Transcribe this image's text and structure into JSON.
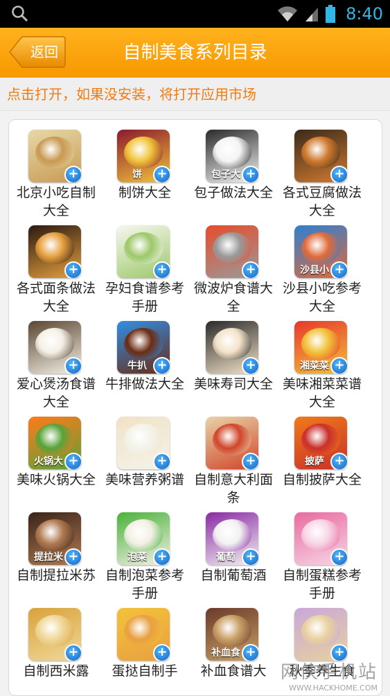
{
  "status_bar": {
    "time": "8:40"
  },
  "header": {
    "back_label": "返回",
    "title": "自制美食系列目录"
  },
  "notice": "点击打开，如果没安装，将打开应用市场",
  "apps": [
    {
      "name": "北京小吃自制大全",
      "icon": "pastry-icon",
      "colors": [
        "#e7d8a8",
        "#c89a52"
      ],
      "tag": ""
    },
    {
      "name": "制饼大全",
      "icon": "pancake-icon",
      "colors": [
        "#8b1a2e",
        "#f2c43a"
      ],
      "tag": "饼"
    },
    {
      "name": "包子做法大全",
      "icon": "bun-icon",
      "colors": [
        "#2a2a2a",
        "#f4f4f4"
      ],
      "tag": "包子大"
    },
    {
      "name": "各式豆腐做法大全",
      "icon": "tofu-icon",
      "colors": [
        "#3a2a1a",
        "#d07a30"
      ],
      "tag": ""
    },
    {
      "name": "各式面条做法大全",
      "icon": "noodle-icon",
      "colors": [
        "#2b1a10",
        "#e6a040"
      ],
      "tag": ""
    },
    {
      "name": "孕妇食谱参考手册",
      "icon": "mother-icon",
      "colors": [
        "#f7f7ef",
        "#9cc86a"
      ],
      "tag": ""
    },
    {
      "name": "微波炉食谱大全",
      "icon": "microwave-icon",
      "colors": [
        "#e74c2a",
        "#9a9a9a"
      ],
      "tag": ""
    },
    {
      "name": "沙县小吃参考大全",
      "icon": "soup-icon",
      "colors": [
        "#2f7fd1",
        "#e06a3a"
      ],
      "tag": "沙县小"
    },
    {
      "name": "爱心煲汤食谱大全",
      "icon": "hotpot-icon",
      "colors": [
        "#5a4632",
        "#f4f0e6"
      ],
      "tag": ""
    },
    {
      "name": "牛排做法大全",
      "icon": "steak-icon",
      "colors": [
        "#2f8ee5",
        "#6b2c14"
      ],
      "tag": "牛扒"
    },
    {
      "name": "美味寿司大全",
      "icon": "sushi-icon",
      "colors": [
        "#2a2a2a",
        "#f3e2c8"
      ],
      "tag": ""
    },
    {
      "name": "美味湘菜菜谱大全",
      "icon": "hunan-dish-icon",
      "colors": [
        "#e8372c",
        "#f2c23a"
      ],
      "tag": "湘菜菜"
    },
    {
      "name": "美味火锅大全",
      "icon": "hot-pot-icon",
      "colors": [
        "#ff7a1a",
        "#5aa23a"
      ],
      "tag": "火锅大"
    },
    {
      "name": "美味营养粥谱",
      "icon": "porridge-icon",
      "colors": [
        "#f2e2c6",
        "#f3f3ea"
      ],
      "tag": ""
    },
    {
      "name": "自制意大利面条",
      "icon": "pasta-icon",
      "colors": [
        "#e8d2a8",
        "#d0462a"
      ],
      "tag": ""
    },
    {
      "name": "自制披萨大全",
      "icon": "pizza-icon",
      "colors": [
        "#f07a1a",
        "#c9302a"
      ],
      "tag": "披萨"
    },
    {
      "name": "自制提拉米苏",
      "icon": "tiramisu-icon",
      "colors": [
        "#3a2418",
        "#b07a52"
      ],
      "tag": "提拉米"
    },
    {
      "name": "自制泡菜参考手册",
      "icon": "kimchi-icon",
      "colors": [
        "#4ab23a",
        "#f4f0e6"
      ],
      "tag": "泡菜"
    },
    {
      "name": "自制葡萄酒",
      "icon": "wine-icon",
      "colors": [
        "#8a2aa2",
        "#f2f2f2"
      ],
      "tag": "葡萄"
    },
    {
      "name": "自制蛋糕参考手册",
      "icon": "cupcake-icon",
      "colors": [
        "#e96aa0",
        "#f7d6e6"
      ],
      "tag": ""
    },
    {
      "name": "自制西米露",
      "icon": "sago-icon",
      "colors": [
        "#d9a23a",
        "#f0d89a"
      ],
      "tag": ""
    },
    {
      "name": "蛋挞自制手",
      "icon": "egg-tart-icon",
      "colors": [
        "#f4c23a",
        "#e8a040"
      ],
      "tag": ""
    },
    {
      "name": "补血食谱大",
      "icon": "blood-soup-icon",
      "colors": [
        "#6a3a2a",
        "#c9a066"
      ],
      "tag": "补血食"
    },
    {
      "name": "秋季养生食",
      "icon": "autumn-dish-icon",
      "colors": [
        "#c9a8d8",
        "#e8d0a0"
      ],
      "tag": ""
    }
  ],
  "watermark": {
    "cn": "网侠手机站",
    "url": "WWW.HACKHOME.COM"
  }
}
